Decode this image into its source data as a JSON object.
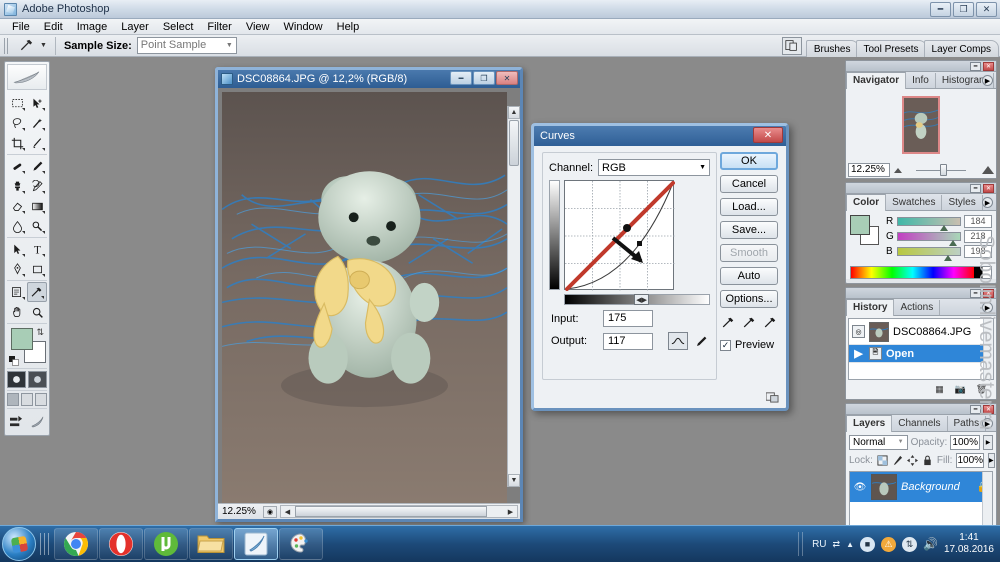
{
  "app": {
    "title": "Adobe Photoshop",
    "window_buttons": [
      "minimize",
      "restore",
      "close"
    ]
  },
  "menubar": {
    "items": [
      "File",
      "Edit",
      "Image",
      "Layer",
      "Select",
      "Filter",
      "View",
      "Window",
      "Help"
    ]
  },
  "options_bar": {
    "tool_icon": "eyedropper-icon",
    "sample_size_label": "Sample Size:",
    "sample_size_value": "Point Sample",
    "dock_tabs": [
      "Brushes",
      "Tool Presets",
      "Layer Comps"
    ]
  },
  "toolbox": {
    "tools": [
      [
        "marquee-icon",
        "move-icon"
      ],
      [
        "lasso-icon",
        "magic-wand-icon"
      ],
      [
        "crop-icon",
        "slice-icon"
      ],
      [
        "healing-brush-icon",
        "brush-icon"
      ],
      [
        "clone-stamp-icon",
        "history-brush-icon"
      ],
      [
        "eraser-icon",
        "gradient-icon"
      ],
      [
        "blur-icon",
        "dodge-icon"
      ],
      [
        "path-selection-icon",
        "type-icon"
      ],
      [
        "pen-icon",
        "shape-icon"
      ],
      [
        "notes-icon",
        "eyedropper-icon"
      ],
      [
        "hand-icon",
        "zoom-icon"
      ]
    ],
    "foreground_color": "#a8cdb6",
    "background_color": "#ffffff",
    "selected_tool": "eyedropper-icon"
  },
  "document": {
    "title": "DSC08864.JPG @ 12,2% (RGB/8)",
    "status_zoom": "12.25%",
    "window_buttons": [
      "minimize",
      "maximize",
      "close"
    ]
  },
  "curves_dialog": {
    "title": "Curves",
    "channel_label": "Channel:",
    "channel_value": "RGB",
    "input_label": "Input:",
    "input_value": "175",
    "output_label": "Output:",
    "output_value": "117",
    "buttons": [
      {
        "label": "OK",
        "state": "primary"
      },
      {
        "label": "Cancel",
        "state": "normal"
      },
      {
        "label": "Load...",
        "state": "normal"
      },
      {
        "label": "Save...",
        "state": "normal"
      },
      {
        "label": "Smooth",
        "state": "disabled"
      },
      {
        "label": "Auto",
        "state": "normal"
      },
      {
        "label": "Options...",
        "state": "normal"
      }
    ],
    "preview_label": "Preview",
    "preview_checked": true,
    "eyedroppers": [
      "black-point-eyedropper-icon",
      "gray-point-eyedropper-icon",
      "white-point-eyedropper-icon"
    ],
    "curve_edit_icon": "curve-tool-icon",
    "pencil_edit_icon": "pencil-tool-icon",
    "accent_color": "#c0392b"
  },
  "palettes": {
    "navigator": {
      "tabs": [
        "Navigator",
        "Info",
        "Histogram"
      ],
      "active_tab": "Navigator",
      "zoom_value": "12.25%"
    },
    "color": {
      "tabs": [
        "Color",
        "Swatches",
        "Styles"
      ],
      "active_tab": "Color",
      "channels": [
        {
          "label": "R",
          "value": "184"
        },
        {
          "label": "G",
          "value": "218"
        },
        {
          "label": "B",
          "value": "198"
        }
      ]
    },
    "history": {
      "tabs": [
        "History",
        "Actions"
      ],
      "active_tab": "History",
      "snapshot": "DSC08864.JPG",
      "states": [
        {
          "label": "Open",
          "selected": true
        }
      ],
      "footer_icons": [
        "new-snapshot-icon",
        "new-document-icon",
        "delete-icon"
      ]
    },
    "layers": {
      "tabs": [
        "Layers",
        "Channels",
        "Paths"
      ],
      "active_tab": "Layers",
      "blend_mode": "Normal",
      "opacity_label": "Opacity:",
      "opacity_value": "100%",
      "lock_label": "Lock:",
      "fill_label": "Fill:",
      "fill_value": "100%",
      "lock_icons": [
        "lock-transparency-icon",
        "lock-image-icon",
        "lock-position-icon",
        "lock-all-icon"
      ],
      "items": [
        {
          "name": "Background",
          "locked": true,
          "visible": true,
          "selected": true
        }
      ],
      "footer_icons": [
        "link-icon",
        "fx-icon",
        "mask-icon",
        "adjustment-icon",
        "group-icon",
        "new-layer-icon",
        "delete-layer-icon"
      ]
    }
  },
  "watermark": "Sobolin.livemaster.ru",
  "taskbar": {
    "start_label": "start-orb-icon",
    "apps": [
      {
        "name": "chrome-icon",
        "active": false
      },
      {
        "name": "opera-icon",
        "active": false
      },
      {
        "name": "utorrent-icon",
        "active": false
      },
      {
        "name": "explorer-icon",
        "active": false
      },
      {
        "name": "photoshop-icon",
        "active": true
      },
      {
        "name": "paint-icon",
        "active": false
      }
    ],
    "language": "RU",
    "tray_icons": [
      "network-icon",
      "security-icon",
      "update-icon",
      "volume-icon"
    ],
    "time": "1:41",
    "date": "17.08.2016"
  }
}
